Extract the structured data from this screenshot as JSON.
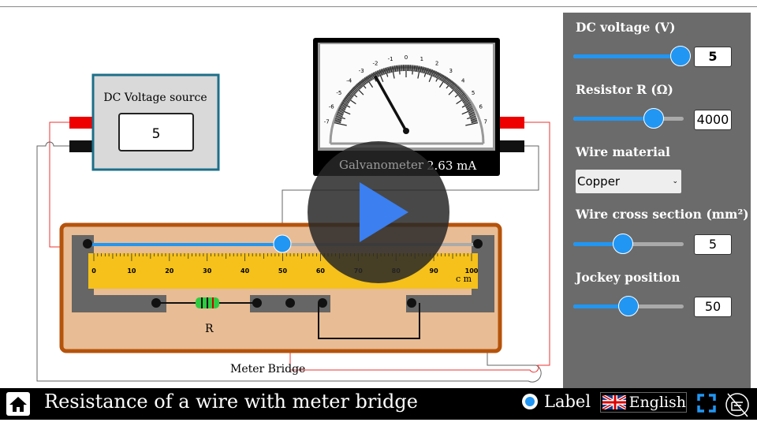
{
  "scene": {
    "dc_source_title": "DC Voltage source",
    "dc_source_value": "5",
    "galvanometer_label": "Galvanometer",
    "galvanometer_reading": "2.63 mA",
    "galvanometer_scale": [
      "-7",
      "-6",
      "-5",
      "-4",
      "-3",
      "-2",
      "-1",
      "0",
      "1",
      "2",
      "3",
      "4",
      "5",
      "6",
      "7"
    ],
    "needle_value": -2.63,
    "ruler_ticks": [
      "0",
      "10",
      "20",
      "30",
      "40",
      "50",
      "60",
      "70",
      "80",
      "90",
      "100"
    ],
    "ruler_unit": "c m",
    "resistor_label": "R",
    "bridge_label": "Meter Bridge"
  },
  "panel": {
    "dc_voltage_label": "DC voltage (V)",
    "dc_voltage_value": "5",
    "dc_voltage_fraction": 1.0,
    "resistor_label": "Resistor R (Ω)",
    "resistor_value": "4000",
    "resistor_fraction": 0.73,
    "wire_material_label": "Wire material",
    "wire_material_value": "Copper",
    "cross_section_label": "Wire cross section (mm²)",
    "cross_section_value": "5",
    "cross_section_fraction": 0.45,
    "jockey_label": "Jockey position",
    "jockey_value": "50",
    "jockey_fraction": 0.5
  },
  "bottom": {
    "title": "Resistance of a wire with meter bridge",
    "label_toggle": "Label",
    "language": "English"
  },
  "colors": {
    "accent": "#2196f3",
    "panel": "#6b6b6b",
    "board": "#e8bc94",
    "board_border": "#b5530b",
    "ruler": "#f5c11a"
  }
}
